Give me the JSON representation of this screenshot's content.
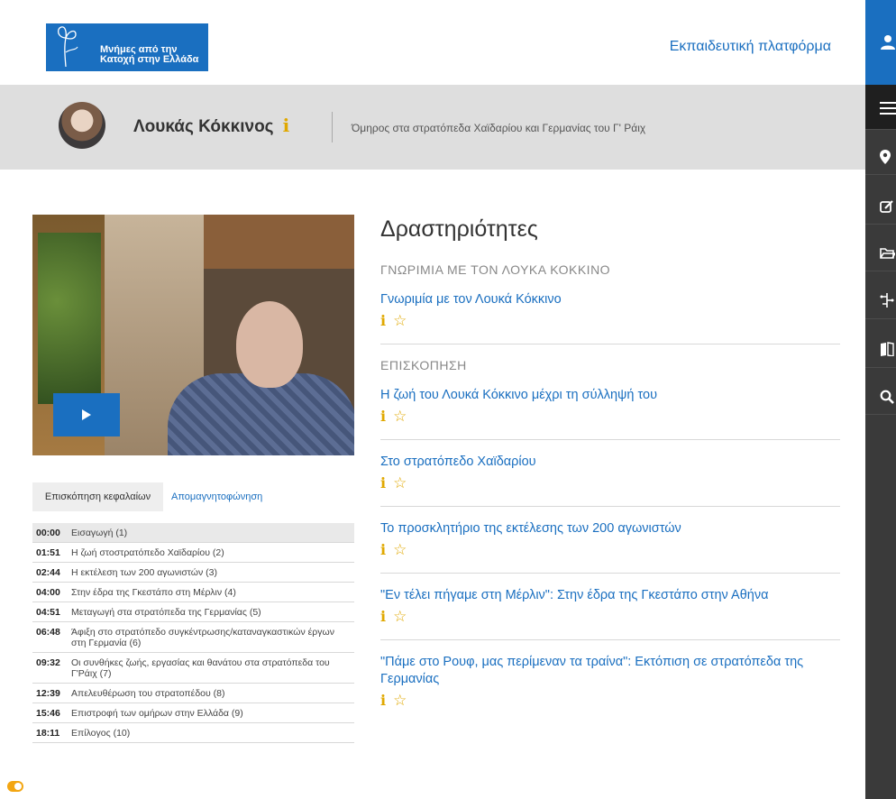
{
  "header": {
    "logo_line1": "Μνήμες από την",
    "logo_line2": "Κατοχή στην Ελλάδα",
    "platform_link": "Εκπαιδευτική πλατφόρμα"
  },
  "person": {
    "name": "Λουκάς Κόκκινος",
    "info_icon": "i",
    "description": "Όμηρος στα στρατόπεδα Χαϊδαρίου και Γερμανίας του Γ' Ράιχ"
  },
  "sidebar_icons": [
    "user-icon",
    "menu-icon",
    "map-pin-icon",
    "edit-icon",
    "folder-icon",
    "timeline-icon",
    "book-icon",
    "search-icon"
  ],
  "video": {
    "play_icon": "play-icon"
  },
  "tabs": {
    "overview": "Επισκόπηση κεφαλαίων",
    "transcript": "Απομαγνητοφώνηση"
  },
  "chapters": [
    {
      "time": "00:00",
      "title": "Εισαγωγή (1)"
    },
    {
      "time": "01:51",
      "title": "Η ζωή στοστρατόπεδο Χαϊδαρίου (2)"
    },
    {
      "time": "02:44",
      "title": "Η εκτέλεση των 200 αγωνιστών (3)"
    },
    {
      "time": "04:00",
      "title": "Στην έδρα της Γκεστάπο στη Μέρλιν (4)"
    },
    {
      "time": "04:51",
      "title": "Μεταγωγή στα στρατόπεδα της Γερμανίας (5)"
    },
    {
      "time": "06:48",
      "title": "Άφιξη στο στρατόπεδο συγκέντρωσης/καταναγκαστικών έργων στη Γερμανία (6)"
    },
    {
      "time": "09:32",
      "title": "Οι συνθήκες ζωής, εργασίας και θανάτου στα στρατόπεδα του Γ'Ράιχ (7)"
    },
    {
      "time": "12:39",
      "title": "Απελευθέρωση του στρατοπέδου (8)"
    },
    {
      "time": "15:46",
      "title": "Επιστροφή των ομήρων στην Ελλάδα (9)"
    },
    {
      "time": "18:11",
      "title": "Επίλογος (10)"
    }
  ],
  "activities": {
    "title": "Δραστηριότητες",
    "sections": [
      {
        "label": "ΓΝΩΡΙΜΙΑ ΜΕ ΤΟΝ ΛΟΥΚΑ ΚΟΚΚΙΝΟ",
        "items": [
          "Γνωριμία με τον Λουκά Κόκκινο"
        ]
      },
      {
        "label": "ΕΠΙΣΚΟΠΗΣΗ",
        "items": [
          "Η ζωή του Λουκά Κόκκινο μέχρι τη σύλληψή του",
          "Στο στρατόπεδο Χαϊδαρίου",
          "Το προσκλητήριο της εκτέλεσης των 200 αγωνιστών",
          "\"Εν τέλει πήγαμε στη Μέρλιν\": Στην έδρα της Γκεστάπο στην Αθήνα",
          "\"Πάμε στο Ρουφ, μας περίμεναν τα τραίνα\": Εκτόπιση σε στρατόπεδα της Γερμανίας"
        ]
      }
    ],
    "info_icon": "i",
    "star_icon": "☆"
  },
  "colors": {
    "accent": "#1a6fc0",
    "info": "#e0a800",
    "rail": "#3a3a3a"
  }
}
